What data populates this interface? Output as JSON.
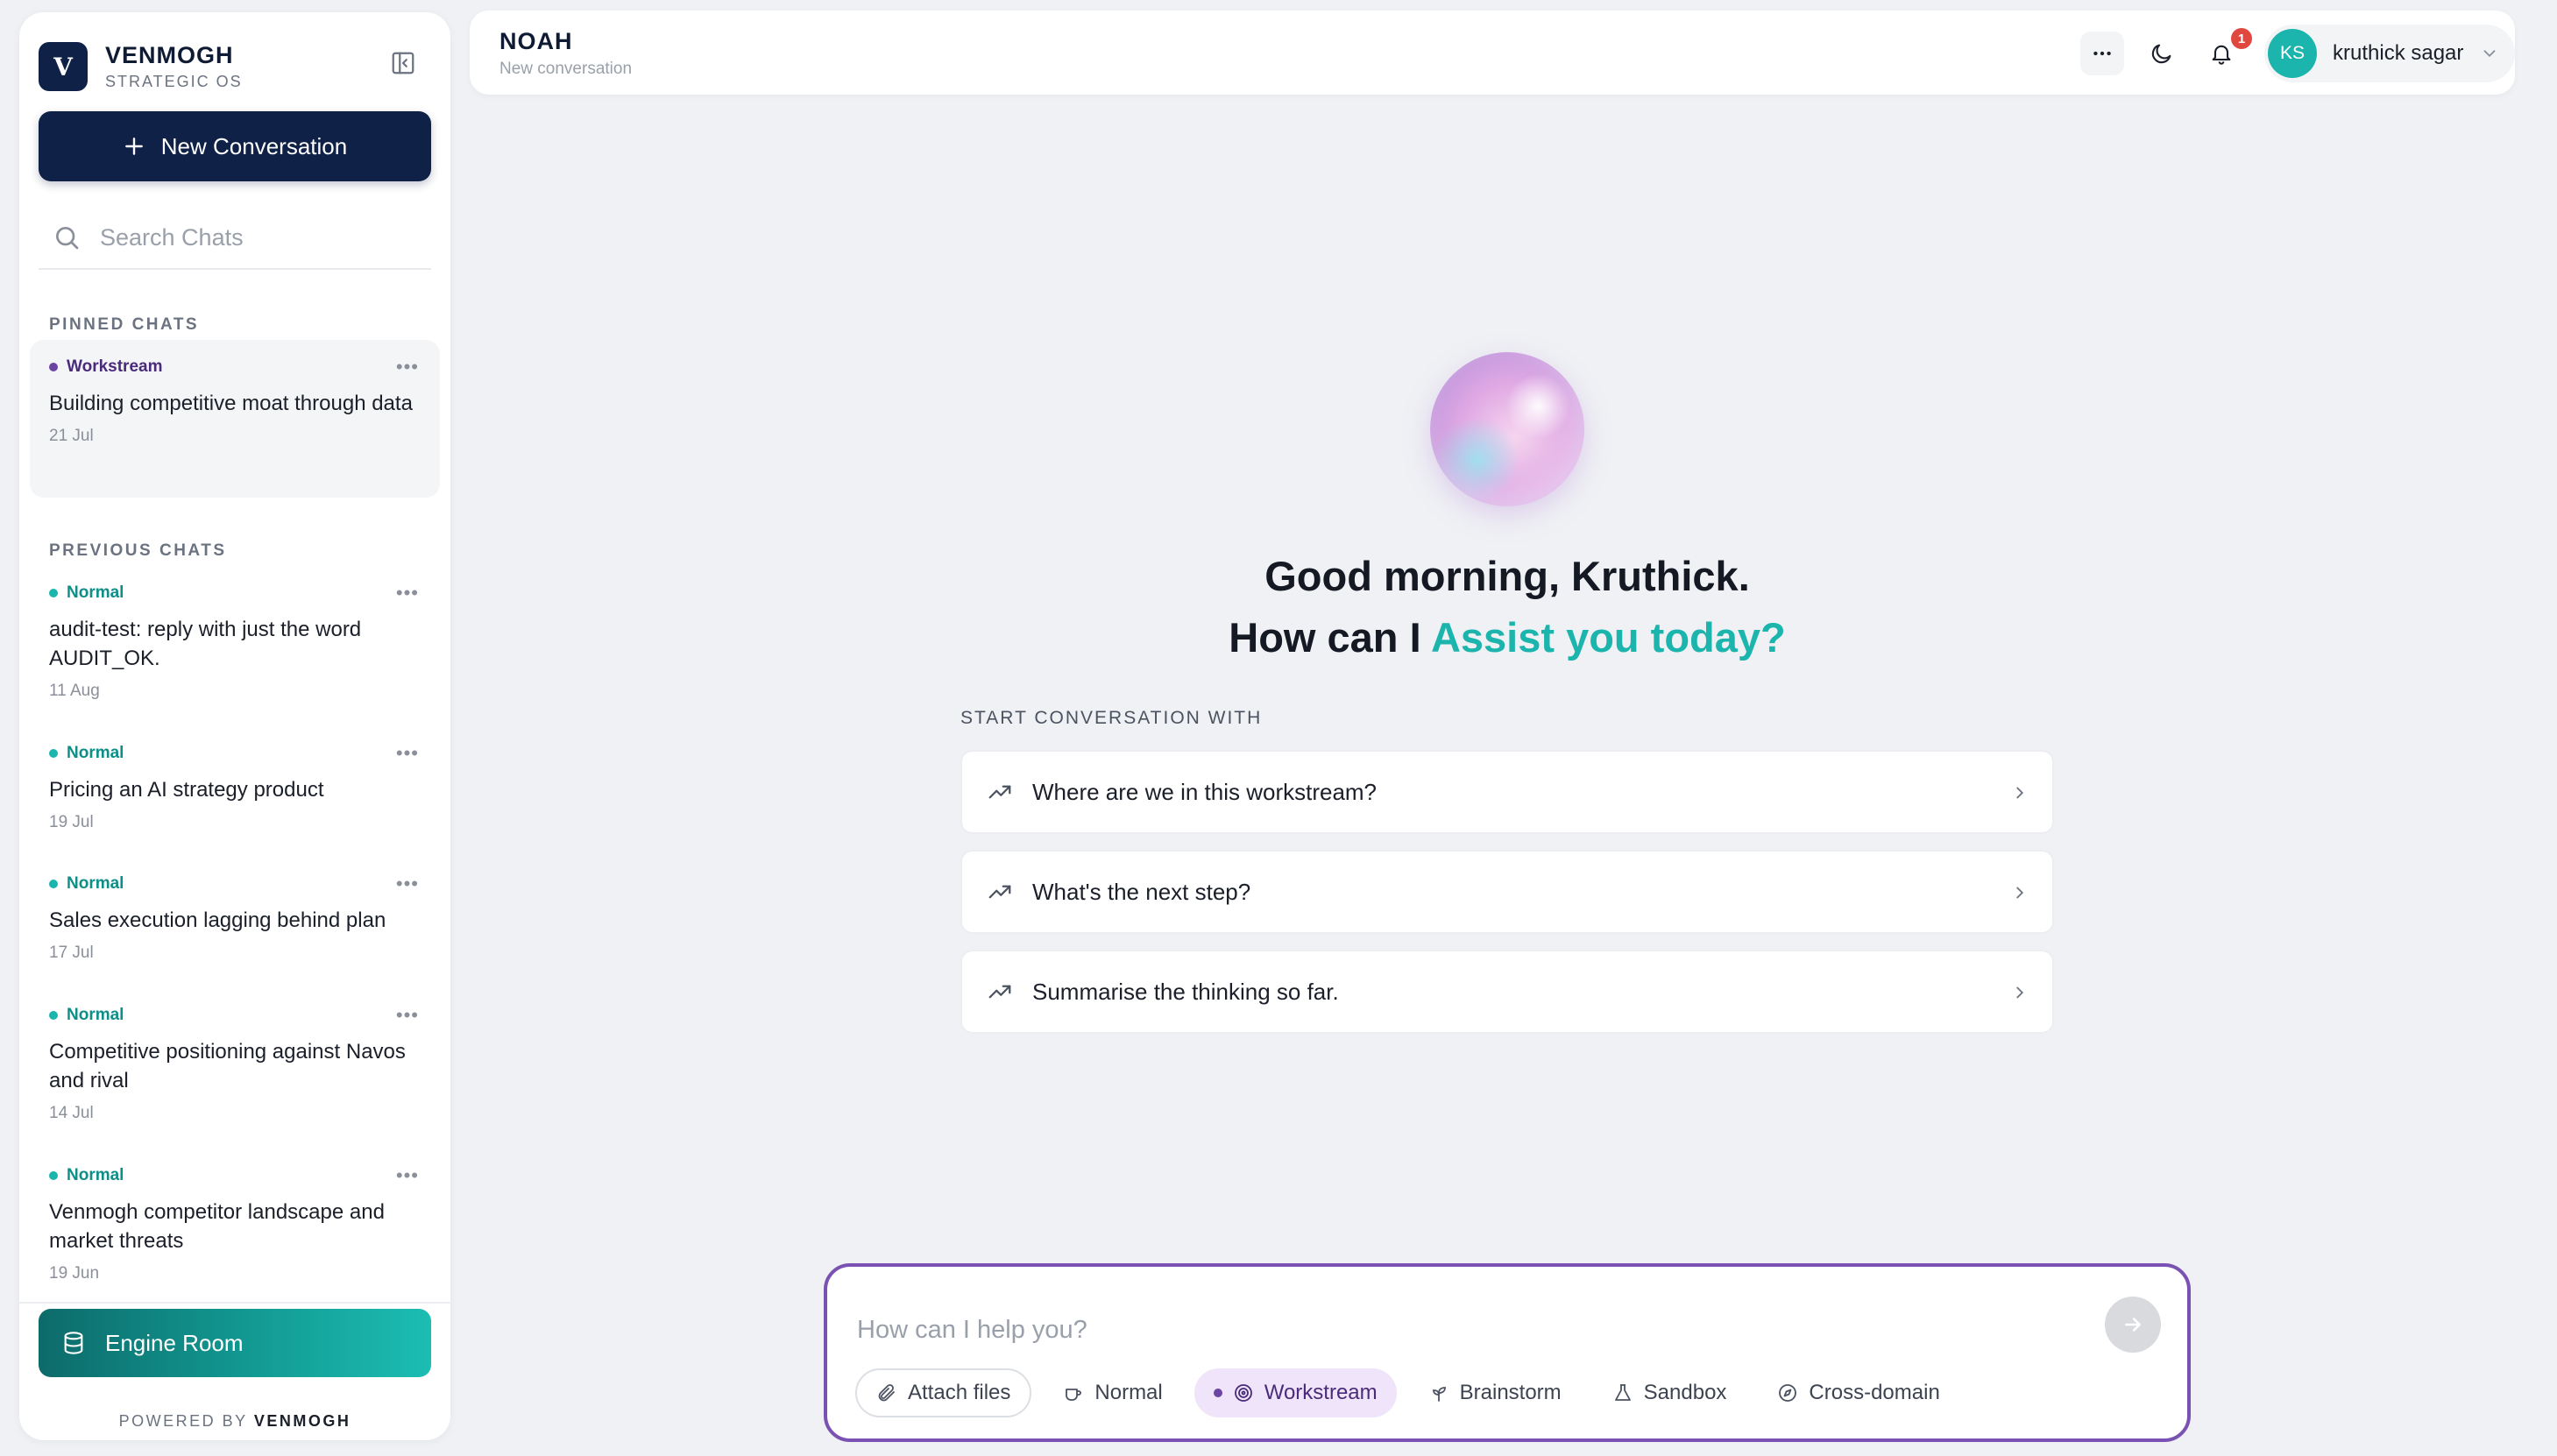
{
  "sidebar": {
    "brand_name": "VENMOGH",
    "brand_sub": "STRATEGIC OS",
    "logo_letter": "V",
    "new_conversation": "New Conversation",
    "search_placeholder": "Search Chats",
    "pinned_label": "PINNED CHATS",
    "previous_label": "PREVIOUS CHATS",
    "pinned": [
      {
        "tag": "Workstream",
        "title": "Building competitive moat through data",
        "date": "21 Jul"
      }
    ],
    "previous": [
      {
        "tag": "Normal",
        "title": "audit-test: reply with just the word AUDIT_OK.",
        "date": "11 Aug"
      },
      {
        "tag": "Normal",
        "title": "Pricing an AI strategy product",
        "date": "19 Jul"
      },
      {
        "tag": "Normal",
        "title": "Sales execution lagging behind plan",
        "date": "17 Jul"
      },
      {
        "tag": "Normal",
        "title": "Competitive positioning against Navos and rival",
        "date": "14 Jul"
      },
      {
        "tag": "Normal",
        "title": "Venmogh competitor landscape and market threats",
        "date": "19 Jun"
      }
    ],
    "engine_room": "Engine Room",
    "powered_prefix": "POWERED BY",
    "powered_brand": "VENMOGH"
  },
  "topbar": {
    "title": "NOAH",
    "subtitle": "New conversation",
    "notification_count": "1",
    "user_initials": "KS",
    "user_name": "kruthick sagar"
  },
  "main": {
    "greeting_line1": "Good morning, Kruthick.",
    "greeting_line2_prefix": "How can I ",
    "greeting_line2_accent": "Assist you today?",
    "start_label": "START CONVERSATION WITH",
    "suggestions": [
      "Where are we in this workstream?",
      "What's the next step?",
      "Summarise the thinking so far."
    ]
  },
  "composer": {
    "placeholder": "How can I help you?",
    "attach": "Attach files",
    "modes": [
      "Normal",
      "Workstream",
      "Brainstorm",
      "Sandbox",
      "Cross-domain"
    ],
    "active_mode": "Workstream"
  },
  "colors": {
    "navy": "#0f2147",
    "teal_accent": "#1cb5ad",
    "workstream_purple": "#6b45a1",
    "composer_border": "#7a52b3",
    "notification_red": "#e0483f"
  },
  "icons": [
    "plus-icon",
    "search-icon",
    "sidebar-collapse-icon",
    "ellipsis-icon",
    "moon-icon",
    "bell-icon",
    "chevron-down-icon",
    "trend-icon",
    "chevron-right-icon",
    "paperclip-icon",
    "cup-icon",
    "target-icon",
    "sprout-icon",
    "flask-icon",
    "compass-icon",
    "arrow-right-icon",
    "database-icon"
  ]
}
